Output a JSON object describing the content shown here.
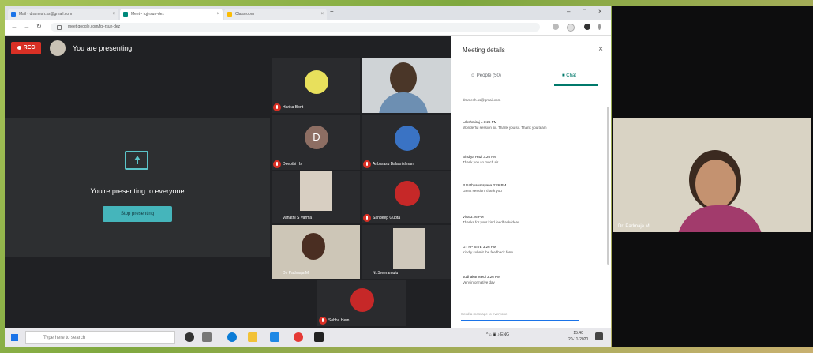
{
  "browser": {
    "tabs": [
      {
        "label": "Mail - dramesh.ss@gmail.com",
        "fav_color": "#1a73e8"
      },
      {
        "label": "Meet - fqj-rsun-dez",
        "fav_color": "#00897b"
      },
      {
        "label": "Classroom",
        "fav_color": "#fbbc04"
      }
    ],
    "url": "meet.google.com/fqj-rsun-dez"
  },
  "meet": {
    "rec_label": "REC",
    "presenting_banner": "You are presenting",
    "stage_message": "You're presenting to everyone",
    "stop_button": "Stop presenting",
    "participants": [
      {
        "name": "Harika Bont"
      },
      {
        "name": "Deepthi Hs",
        "initial": "D"
      },
      {
        "name": "Anbarasu Balakrishnan"
      },
      {
        "name": "Vanathi S Varma"
      },
      {
        "name": "Sandeep Gupta"
      },
      {
        "name": "Dr. Padmaja M"
      },
      {
        "name": "N. Sreeramulu"
      },
      {
        "name": "Sobha Hem"
      }
    ]
  },
  "panel": {
    "title": "Meeting details",
    "tab_people": "People (50)",
    "tab_chat": "Chat",
    "chat": [
      {
        "who": "",
        "text": "dramesh.ss@gmail.com"
      },
      {
        "who": "Lakshmiraj L  3:26 PM",
        "text": "Wonderful session sir. Thank you sir. Thank you team"
      },
      {
        "who": "Bindiya Hazi  3:26 PM",
        "text": "Thank you so much sir"
      },
      {
        "who": "R Sathyanarayana  3:26 PM",
        "text": "Great session, thank you"
      },
      {
        "who": "Viva  3:26 PM",
        "text": "Thanks for your kind feedback/ideas"
      },
      {
        "who": "GT FP SIVE  3:26 PM",
        "text": "Kindly submit the feedback form"
      },
      {
        "who": "sudhakar reedi  3:26 PM",
        "text": "Very informative day"
      }
    ],
    "send_placeholder": "Send a message to everyone"
  },
  "taskbar": {
    "search_placeholder": "Type here to search",
    "time": "15:40",
    "date": "20-11-2020"
  },
  "side_video": {
    "name": "Dr. Padmaja M"
  }
}
